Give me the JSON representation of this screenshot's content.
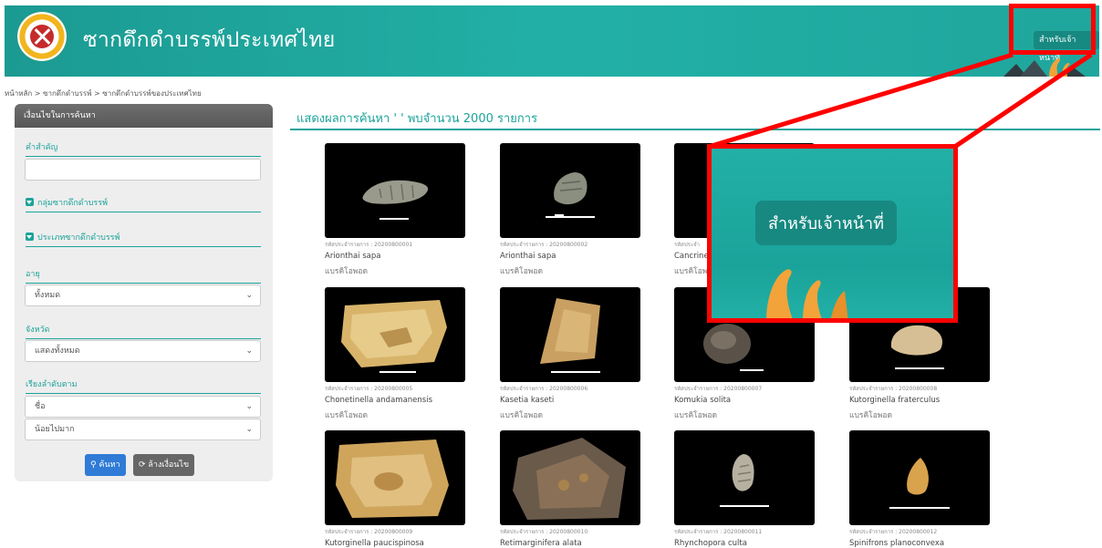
{
  "header": {
    "title": "ซากดึกดำบรรพ์ประเทศไทย",
    "staff_button": "สำหรับเจ้าหน้าที่"
  },
  "breadcrumb": "หน้าหลัก > ซากดึกดำบรรพ์ > ซากดึกดำบรรพ์ของประเทศไทย",
  "sidebar": {
    "heading": "เงื่อนไขในการค้นหา",
    "keyword_label": "คำสำคัญ",
    "group_label": "กลุ่มซากดึกดำบรรพ์",
    "type_label": "ประเภทซากดึกดำบรรพ์",
    "age_label": "อายุ",
    "age_value": "ทั้งหมด",
    "province_label": "จังหวัด",
    "province_value": "แสดงทั้งหมด",
    "sort_label": "เรียงลำดับตาม",
    "sort_field_value": "ชื่อ",
    "sort_order_value": "น้อยไปมาก",
    "search_button": "ค้นหา",
    "clear_button": "ล้างเงื่อนไข"
  },
  "results": {
    "title": "แสดงผลการค้นหา ' ' พบจำนวน 2000 รายการ",
    "items": [
      {
        "code": "รหัสประจำรายการ : 20200800001",
        "name": "Arionthai sapa",
        "category": "แบรคิโอพอด"
      },
      {
        "code": "รหัสประจำรายการ : 20200800002",
        "name": "Arionthai sapa",
        "category": "แบรคิโอพอด"
      },
      {
        "code": "รหัสประจำ",
        "name": "Cancrine",
        "category": "แบรคิโอพ"
      },
      {
        "code": "",
        "name": "",
        "category": ""
      },
      {
        "code": "รหัสประจำรายการ : 20200800005",
        "name": "Chonetinella andamanensis",
        "category": "แบรคิโอพอด"
      },
      {
        "code": "รหัสประจำรายการ : 20200800006",
        "name": "Kasetia kaseti",
        "category": "แบรคิโอพอด"
      },
      {
        "code": "รหัสประจำรายการ : 20200800007",
        "name": "Komukia solita",
        "category": "แบรคิโอพอด"
      },
      {
        "code": "รหัสประจำรายการ : 20200800008",
        "name": "Kutorginella fraterculus",
        "category": "แบรคิโอพอด"
      },
      {
        "code": "รหัสประจำรายการ : 20200800009",
        "name": "Kutorginella paucispinosa",
        "category": ""
      },
      {
        "code": "รหัสประจำรายการ : 20200800010",
        "name": "Retimarginifera alata",
        "category": ""
      },
      {
        "code": "รหัสประจำรายการ : 20200800011",
        "name": "Rhynchopora culta",
        "category": ""
      },
      {
        "code": "รหัสประจำรายการ : 20200800012",
        "name": "Spinifrons planoconvexa",
        "category": ""
      }
    ]
  },
  "zoom": {
    "staff_button": "สำหรับเจ้าหน้าที่"
  },
  "colors": {
    "header": "#1fa69d",
    "accent": "#1ba39a",
    "highlight": "#ff0000"
  }
}
